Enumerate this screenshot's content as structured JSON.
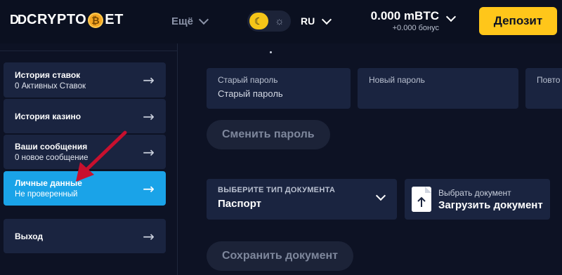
{
  "header": {
    "logo_left": "DD",
    "logo_main": "CRYPTO",
    "logo_coin": "₿",
    "logo_right": "ET",
    "more_label": "Ещё",
    "language": "RU",
    "balance": "0.000 mBTC",
    "bonus": "+0.000 бонус",
    "deposit_label": "Депозит"
  },
  "sidebar": {
    "items": [
      {
        "title": "История ставок",
        "sub": "0 Активных Ставок"
      },
      {
        "title": "История казино",
        "sub": ""
      },
      {
        "title": "Ваши сообщения",
        "sub": "0 новое сообщение"
      },
      {
        "title": "Личные данные",
        "sub": "Не проверенный"
      },
      {
        "title": "Выход",
        "sub": ""
      }
    ],
    "arrow": "→"
  },
  "password": {
    "old_label": "Старый пароль",
    "old_placeholder": "Старый пароль",
    "new_label": "Новый пароль",
    "repeat_label": "Повто",
    "change_button": "Сменить пароль"
  },
  "document": {
    "type_label": "ВЫБЕРИТЕ ТИП ДОКУМЕНТА",
    "type_value": "Паспорт",
    "upload_small": "Выбрать документ",
    "upload_main": "Загрузить документ",
    "save_button": "Сохранить документ"
  },
  "colors": {
    "accent": "#ffc61a",
    "active_item": "#1aa3e8",
    "annotation_arrow": "#c8102e"
  }
}
